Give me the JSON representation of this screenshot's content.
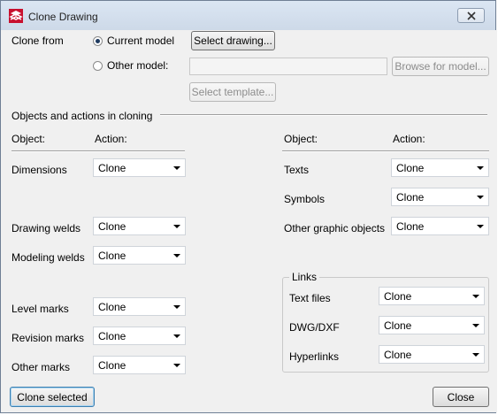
{
  "window": {
    "title": "Clone Drawing"
  },
  "clone_from": {
    "label": "Clone from",
    "current_model_label": "Current model",
    "other_model_label": "Other model:",
    "selected": "current_model",
    "select_drawing_label": "Select drawing...",
    "browse_label": "Browse for model...",
    "select_template_label": "Select template...",
    "other_model_path": ""
  },
  "objects_section": {
    "title": "Objects and actions in cloning",
    "left_headers": {
      "object": "Object:",
      "action": "Action:"
    },
    "right_headers": {
      "object": "Object:",
      "action": "Action:"
    },
    "left_rows": [
      {
        "object": "Dimensions",
        "action": "Clone"
      },
      {
        "object": "Drawing welds",
        "action": "Clone"
      },
      {
        "object": "Modeling welds",
        "action": "Clone"
      },
      {
        "object": "Level marks",
        "action": "Clone"
      },
      {
        "object": "Revision marks",
        "action": "Clone"
      },
      {
        "object": "Other marks",
        "action": "Clone"
      }
    ],
    "right_rows": [
      {
        "object": "Texts",
        "action": "Clone"
      },
      {
        "object": "Symbols",
        "action": "Clone"
      },
      {
        "object": "Other graphic objects",
        "action": "Clone"
      }
    ],
    "links": {
      "title": "Links",
      "rows": [
        {
          "object": "Text files",
          "action": "Clone"
        },
        {
          "object": "DWG/DXF",
          "action": "Clone"
        },
        {
          "object": "Hyperlinks",
          "action": "Clone"
        }
      ]
    }
  },
  "footer": {
    "clone_selected_label": "Clone selected",
    "close_label": "Close"
  }
}
